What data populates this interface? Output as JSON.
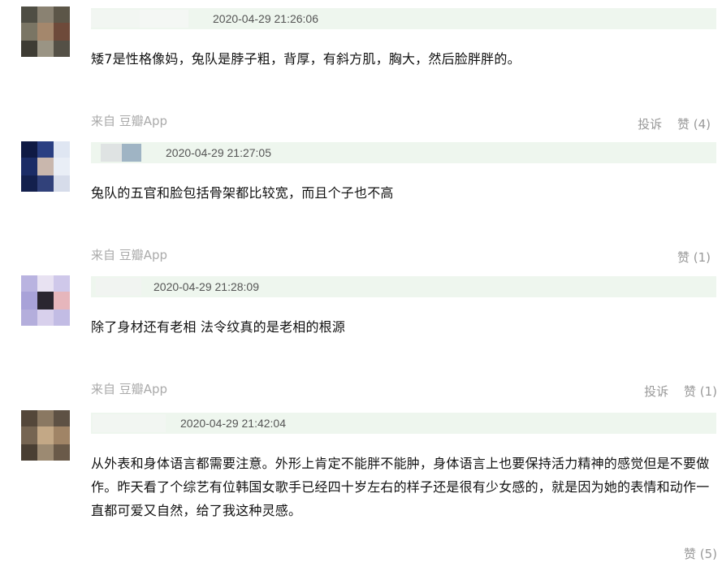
{
  "comments": [
    {
      "time": "2020-04-29 21:26:06",
      "text": "矮7是性格像妈，兔队是脖子粗，背厚，有斜方肌，胸大，然后脸胖胖的。",
      "source": "来自 豆瓣App",
      "report": "投诉",
      "likes": "赞 (4)"
    },
    {
      "time": "2020-04-29 21:27:05",
      "text": "兔队的五官和脸包括骨架都比较宽，而且个子也不高",
      "source": "来自 豆瓣App",
      "likes": "赞 (1)"
    },
    {
      "time": "2020-04-29 21:28:09",
      "text": "除了身材还有老相 法令纹真的是老相的根源",
      "source": "来自 豆瓣App",
      "report": "投诉",
      "likes": "赞 (1)"
    },
    {
      "time": "2020-04-29 21:42:04",
      "text": "从外表和身体语言都需要注意。外形上肯定不能胖不能肿，身体语言上也要保持活力精神的感觉但是不要做作。昨天看了个综艺有位韩国女歌手已经四十岁左右的样子还是很有少女感的，就是因为她的表情和动作一直都可爱又自然，给了我这种灵感。",
      "likes": "赞 (5)"
    }
  ]
}
